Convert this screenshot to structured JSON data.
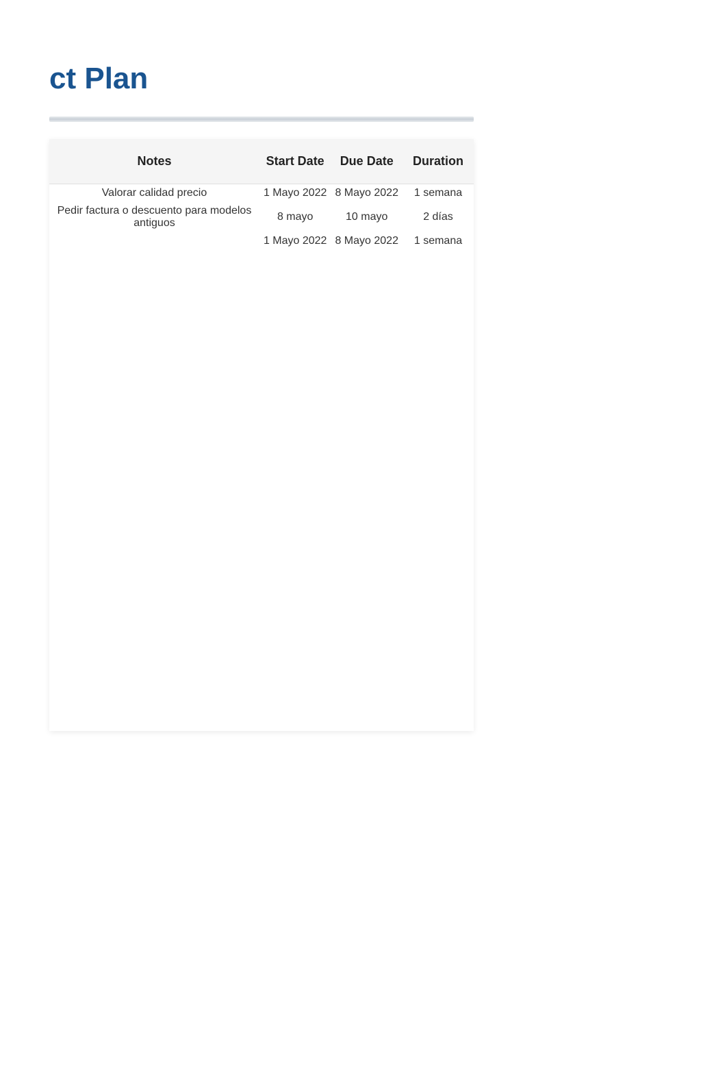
{
  "title": "ct Plan",
  "columns": {
    "notes": "Notes",
    "start": "Start Date",
    "due": "Due Date",
    "duration": "Duration"
  },
  "rows": [
    {
      "notes": "Valorar calidad precio",
      "start": "1 Mayo 2022",
      "due": "8 Mayo 2022",
      "duration": "1 semana",
      "faded": false
    },
    {
      "notes": "Pedir factura o descuento para modelos antiguos",
      "start": "8 mayo",
      "due": "10 mayo",
      "duration": "2 días",
      "faded": false
    },
    {
      "notes": "",
      "start": "1 Mayo 2022",
      "due": "8 Mayo 2022",
      "duration": "1 semana",
      "faded": false
    },
    {
      "notes": "",
      "start": "",
      "due": "",
      "duration": "",
      "faded": true
    },
    {
      "notes": "",
      "start": "",
      "due": "",
      "duration": "",
      "faded": true
    },
    {
      "notes": "",
      "start": "",
      "due": "",
      "duration": "",
      "faded": true
    },
    {
      "notes": "",
      "start": "",
      "due": "",
      "duration": "",
      "faded": true
    },
    {
      "notes": "",
      "start": "",
      "due": "",
      "duration": "",
      "faded": true
    },
    {
      "notes": "",
      "start": "",
      "due": "",
      "duration": "",
      "faded": true
    },
    {
      "notes": "",
      "start": "",
      "due": "",
      "duration": "",
      "faded": true
    },
    {
      "notes": "",
      "start": "",
      "due": "",
      "duration": "",
      "faded": true
    },
    {
      "notes": "",
      "start": "",
      "due": "",
      "duration": "",
      "faded": true
    },
    {
      "notes": "",
      "start": "",
      "due": "",
      "duration": "",
      "faded": true
    },
    {
      "notes": "",
      "start": "",
      "due": "",
      "duration": "",
      "faded": true
    },
    {
      "notes": "",
      "start": "",
      "due": "",
      "duration": "",
      "faded": true
    },
    {
      "notes": "",
      "start": "",
      "due": "",
      "duration": "",
      "faded": true
    },
    {
      "notes": "",
      "start": "",
      "due": "",
      "duration": "",
      "faded": true
    },
    {
      "notes": "",
      "start": "",
      "due": "",
      "duration": "",
      "faded": true
    },
    {
      "notes": "",
      "start": "",
      "due": "",
      "duration": "",
      "faded": true
    },
    {
      "notes": "",
      "start": "",
      "due": "",
      "duration": "",
      "faded": true
    },
    {
      "notes": "",
      "start": "",
      "due": "",
      "duration": "",
      "faded": true
    },
    {
      "notes": "",
      "start": "",
      "due": "",
      "duration": "",
      "faded": true
    },
    {
      "notes": "",
      "start": "",
      "due": "",
      "duration": "",
      "faded": true
    },
    {
      "notes": "",
      "start": "",
      "due": "",
      "duration": "",
      "faded": true
    },
    {
      "notes": "",
      "start": "",
      "due": "",
      "duration": "",
      "faded": true
    },
    {
      "notes": "",
      "start": "",
      "due": "",
      "duration": "",
      "faded": true
    },
    {
      "notes": "",
      "start": "",
      "due": "",
      "duration": "",
      "faded": true
    },
    {
      "notes": "",
      "start": "",
      "due": "",
      "duration": "",
      "faded": true
    },
    {
      "notes": "",
      "start": "",
      "due": "",
      "duration": "",
      "faded": true
    },
    {
      "notes": "",
      "start": "",
      "due": "",
      "duration": "",
      "faded": true
    }
  ]
}
